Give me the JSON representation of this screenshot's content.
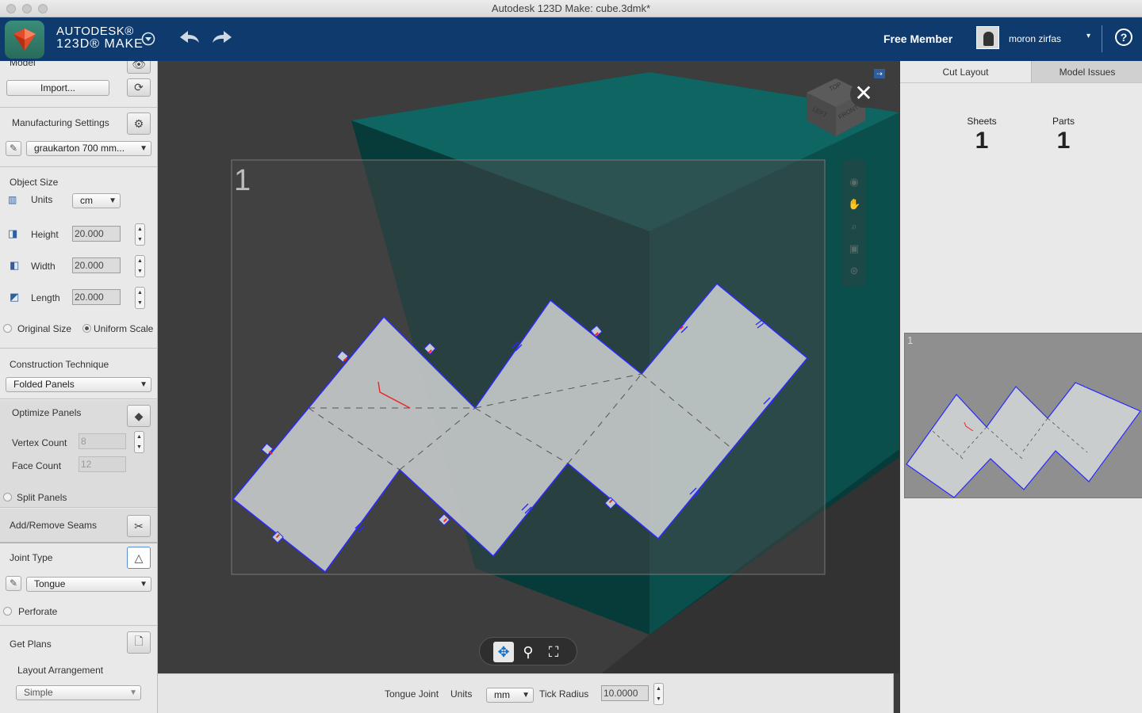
{
  "window": {
    "title": "Autodesk 123D Make: cube.3dmk*"
  },
  "header": {
    "brand_line1": "AUTODESK®",
    "brand_line2": "123D® MAKE",
    "member_label": "Free Member",
    "username": "moron zirfas",
    "help_label": "?"
  },
  "left_panel": {
    "model": {
      "title": "Model",
      "import_label": "Import..."
    },
    "manufacturing": {
      "title": "Manufacturing Settings",
      "material": "graukarton 700 mm..."
    },
    "object_size": {
      "title": "Object Size",
      "units_label": "Units",
      "units_value": "cm",
      "height_label": "Height",
      "height_value": "20.000",
      "width_label": "Width",
      "width_value": "20.000",
      "length_label": "Length",
      "length_value": "20.000",
      "original_size_label": "Original Size",
      "uniform_scale_label": "Uniform Scale"
    },
    "construction": {
      "title": "Construction Technique",
      "value": "Folded Panels"
    },
    "optimize": {
      "title": "Optimize Panels",
      "vertex_label": "Vertex Count",
      "vertex_value": "8",
      "face_label": "Face Count",
      "face_value": "12",
      "split_label": "Split Panels"
    },
    "seams": {
      "title": "Add/Remove Seams"
    },
    "joint": {
      "title": "Joint Type",
      "value": "Tongue",
      "perforate_label": "Perforate"
    },
    "plans": {
      "title": "Get Plans",
      "layout_label": "Layout Arrangement",
      "layout_value": "Simple"
    }
  },
  "viewport": {
    "sheet_number": "1",
    "net_face_label": "1",
    "viewcube": {
      "top": "TOP",
      "left": "LEFT",
      "front": "FRONT"
    }
  },
  "bottom_bar": {
    "joint_label": "Tongue Joint",
    "units_label": "Units",
    "units_value": "mm",
    "tick_label": "Tick Radius",
    "tick_value": "10.0000"
  },
  "right_panel": {
    "tabs": [
      {
        "label": "Cut Layout",
        "active": true
      },
      {
        "label": "Model Issues",
        "active": false
      }
    ],
    "sheets_label": "Sheets",
    "sheets_value": "1",
    "parts_label": "Parts",
    "parts_value": "1",
    "thumb_number": "1",
    "thumb_face_label": "1"
  },
  "colors": {
    "header_bg": "#0e3a6e",
    "model_teal": "#0b5a58",
    "net_fill": "#b9bdbd",
    "net_edge": "#2a2aff",
    "tick_red": "#ff2020"
  },
  "icons": {
    "logo": "123d-make-logo",
    "undo": "undo-arrow-icon",
    "redo": "redo-arrow-icon",
    "eye": "eye-icon",
    "refresh": "refresh-icon",
    "settings": "gear-icon",
    "pencil": "pencil-icon",
    "optimize": "pyramid-icon",
    "seams": "scissors-icon",
    "joint": "triangle-icon",
    "plans": "document-icon",
    "close": "close-icon",
    "pan": "pan-icon",
    "zoom": "zoom-icon",
    "fit": "fit-view-icon"
  }
}
